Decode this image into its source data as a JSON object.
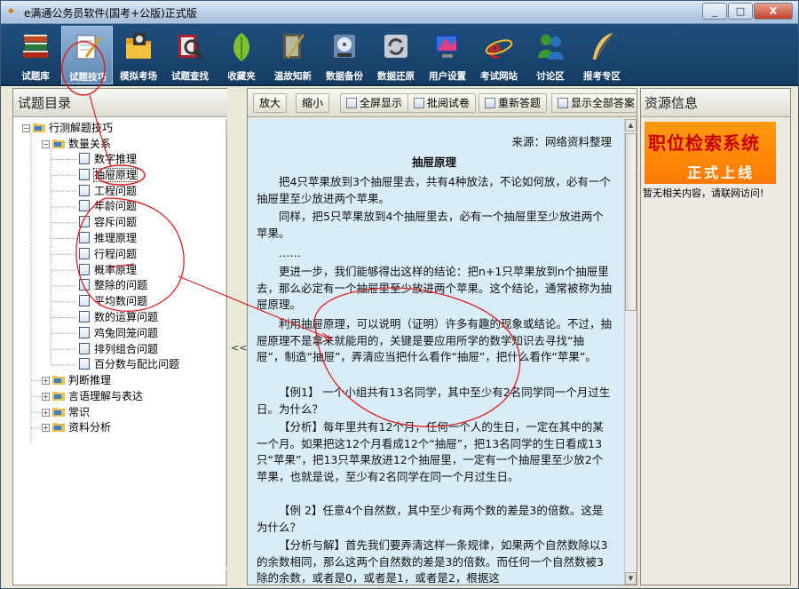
{
  "window": {
    "title": "e满通公务员软件(国考+公版)正式版",
    "controls": [
      "_",
      "□",
      "X"
    ]
  },
  "toolbar": {
    "items": [
      {
        "label": "试题库",
        "icon": "books-icon"
      },
      {
        "label": "试题技巧",
        "icon": "notepad-pen-icon"
      },
      {
        "label": "模拟考场",
        "icon": "folder-icon"
      },
      {
        "label": "试题查找",
        "icon": "magnifier-icon"
      },
      {
        "label": "收藏夹",
        "icon": "leaf-icon"
      },
      {
        "label": "温故知新",
        "icon": "book-pen-icon"
      },
      {
        "label": "数据备份",
        "icon": "disk-icon"
      },
      {
        "label": "数据还原",
        "icon": "restore-icon"
      },
      {
        "label": "用户设置",
        "icon": "monitor-icon"
      },
      {
        "label": "考试网站",
        "icon": "ie-icon"
      },
      {
        "label": "讨论区",
        "icon": "users-icon"
      },
      {
        "label": "报考专区",
        "icon": "quill-icon"
      }
    ],
    "active": "试题技巧"
  },
  "left_panel": {
    "title": "试题目录",
    "tree": {
      "root": "行测解题技巧",
      "group": "数量关系",
      "leaves": [
        "数字推理",
        "抽屉原理",
        "工程问题",
        "年龄问题",
        "容斥问题",
        "推理原理",
        "行程问题",
        "概率原理",
        "整除的问题",
        "平均数问题",
        "数的运算问题",
        "鸡兔同笼问题",
        "排列组合问题",
        "百分数与配比问题"
      ],
      "selected": "抽屉原理",
      "siblings": [
        "判断推理",
        "言语理解与表达",
        "常识",
        "资料分析"
      ]
    },
    "splitter_grip": "<<"
  },
  "center_panel": {
    "buttons": [
      "放大",
      "缩小",
      "全屏显示",
      "批阅试卷",
      "重新答题",
      "显示全部答案"
    ],
    "article": {
      "source": "来源：网络资料整理",
      "title": "抽屉原理",
      "paragraphs": [
        "把4只苹果放到3个抽屉里去，共有4种放法，不论如何放，必有一个抽屉里至少放进两个苹果。",
        "同样，把5只苹果放到4个抽屉里去，必有一个抽屉里至少放进两个苹果。",
        "……",
        "更进一步，我们能够得出这样的结论：把n+1只苹果放到n个抽屉里去，那么必定有一个抽屉里至少放进两个苹果。这个结论，通常被称为抽屉原理。",
        "利用抽屉原理，可以说明（证明）许多有趣的现象或结论。不过，抽屉原理不是拿来就能用的，关键是要应用所学的数学知识去寻找“抽屉”，制造“抽屉”，弄清应当把什么看作“抽屉”，把什么看作“苹果”。",
        "【例1】 一个小组共有13名同学，其中至少有2名同学同一个月过生日。为什么？",
        "【分析】每年里共有12个月，任何一个人的生日，一定在其中的某一个月。如果把这12个月看成12个“抽屉”，把13名同学的生日看成13只“苹果”，把13只苹果放进12个抽屉里，一定有一个抽屉里至少放2个苹果，也就是说，至少有2名同学在同一个月过生日。",
        "【例 2】任意4个自然数，其中至少有两个数的差是3的倍数。这是为什么？",
        "【分析与解】首先我们要弄清这样一条规律，如果两个自然数除以3的余数相同，那么这两个自然数的差是3的倍数。而任何一个自然数被3除的余数，或者是0，或者是1，或者是2，根据这"
      ]
    }
  },
  "right_panel": {
    "title": "资源信息",
    "banner_line1": "职位检索系统",
    "banner_line2": "正式上线",
    "notice": "暂无相关内容，请联网访问!"
  },
  "colors": {
    "toolbar_bg": "#1f4f7e",
    "content_bg": "#d9edf9",
    "banner_orange": "#ff8a00",
    "banner_red": "#c80000",
    "annotation_red": "#e02020"
  }
}
